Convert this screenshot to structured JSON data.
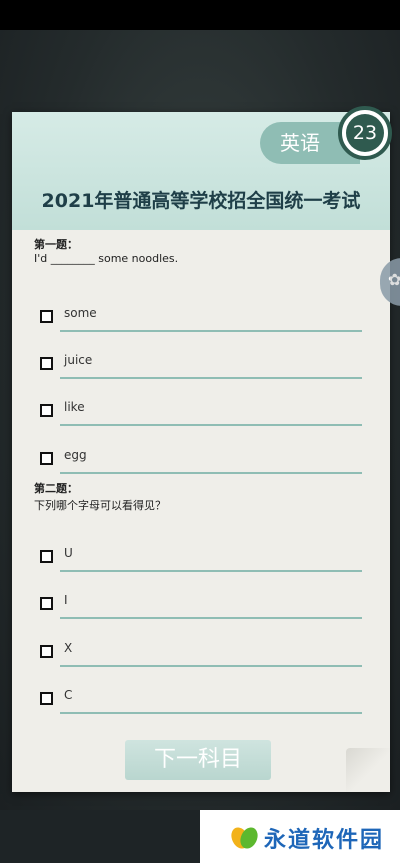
{
  "header": {
    "subject": "英语",
    "timer": "23",
    "exam_title": "2021年普通高等学校招全国统一考试"
  },
  "questions": [
    {
      "label": "第一题：",
      "text": "I'd ________ some noodles.",
      "options": [
        "some",
        "juice",
        "like",
        "egg"
      ]
    },
    {
      "label": "第二题：",
      "text": "下列哪个字母可以看得见？",
      "options": [
        "U",
        "I",
        "X",
        "C"
      ]
    }
  ],
  "footer": {
    "next_button": "下一科目"
  },
  "watermark": {
    "text": "永道软件园"
  },
  "colors": {
    "accent": "#8fbdb4",
    "timer": "#2f5a4f",
    "title": "#1f3f48"
  }
}
